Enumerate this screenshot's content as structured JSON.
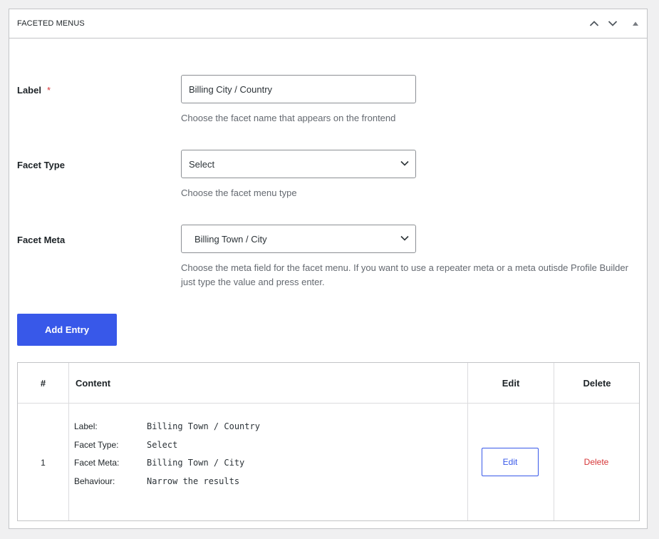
{
  "panel": {
    "title": "FACETED MENUS",
    "controls": [
      "chevron-up-icon",
      "chevron-down-icon",
      "triangle-up-icon"
    ]
  },
  "form": {
    "label": {
      "label": "Label",
      "required_mark": "*",
      "value": "Billing City / Country",
      "help": "Choose the facet name that appears on the frontend"
    },
    "facet_type": {
      "label": "Facet Type",
      "selected": "Select",
      "help": "Choose the facet menu type"
    },
    "facet_meta": {
      "label": "Facet Meta",
      "selected": "Billing Town / City",
      "help": "Choose the meta field for the facet menu. If you want to use a repeater meta or a meta outisde Profile Builder just type the value and press enter."
    },
    "add_button": "Add Entry"
  },
  "table": {
    "headers": [
      "#",
      "Content",
      "Edit",
      "Delete"
    ],
    "rows": [
      {
        "number": "1",
        "fields": [
          {
            "key": "Label:",
            "value": "Billing Town / Country"
          },
          {
            "key": "Facet Type:",
            "value": "Select"
          },
          {
            "key": "Facet Meta:",
            "value": "Billing Town / City"
          },
          {
            "key": "Behaviour:",
            "value": "Narrow the results"
          }
        ],
        "edit_label": "Edit",
        "delete_label": "Delete"
      }
    ]
  },
  "colors": {
    "accent": "#3858e9",
    "danger": "#d63638",
    "muted_text": "#646970",
    "border": "#c3c4c7"
  }
}
